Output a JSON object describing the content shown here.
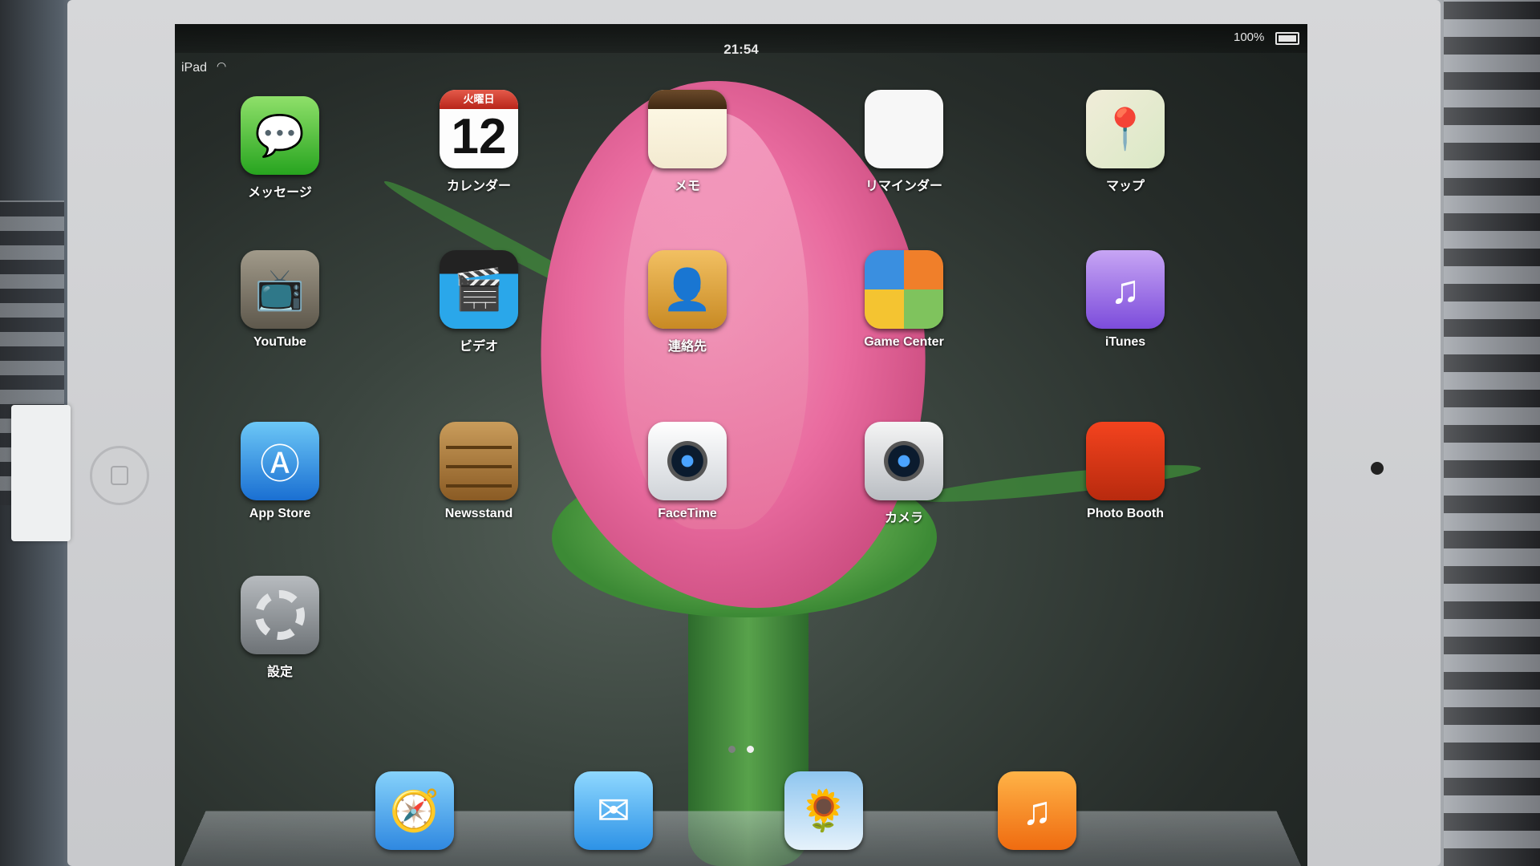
{
  "status_bar": {
    "device": "iPad",
    "time": "21:54",
    "battery": "100%"
  },
  "apps": [
    {
      "label": "メッセージ",
      "icon": "messages-icon"
    },
    {
      "label": "カレンダー",
      "icon": "calendar-icon",
      "weekday": "火曜日",
      "day": "12"
    },
    {
      "label": "メモ",
      "icon": "notes-icon"
    },
    {
      "label": "リマインダー",
      "icon": "reminders-icon"
    },
    {
      "label": "マップ",
      "icon": "maps-icon"
    },
    {
      "label": "YouTube",
      "icon": "youtube-icon"
    },
    {
      "label": "ビデオ",
      "icon": "videos-icon"
    },
    {
      "label": "連絡先",
      "icon": "contacts-icon"
    },
    {
      "label": "Game Center",
      "icon": "game-center-icon"
    },
    {
      "label": "iTunes",
      "icon": "itunes-icon"
    },
    {
      "label": "App Store",
      "icon": "app-store-icon"
    },
    {
      "label": "Newsstand",
      "icon": "newsstand-icon"
    },
    {
      "label": "FaceTime",
      "icon": "facetime-icon"
    },
    {
      "label": "カメラ",
      "icon": "camera-icon"
    },
    {
      "label": "Photo Booth",
      "icon": "photo-booth-icon"
    },
    {
      "label": "設定",
      "icon": "settings-icon"
    }
  ],
  "page_indicator": {
    "pages": 2,
    "current": 2
  },
  "dock": [
    {
      "icon": "safari-icon"
    },
    {
      "icon": "mail-icon"
    },
    {
      "icon": "photos-icon"
    },
    {
      "icon": "music-icon"
    }
  ]
}
